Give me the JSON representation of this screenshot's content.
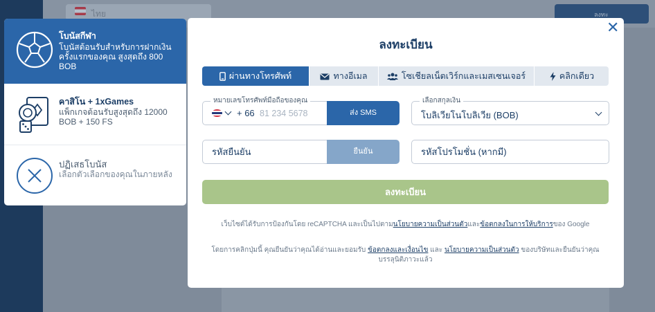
{
  "background": {
    "language_selector": "ไทย",
    "header_button": "ลงทะ"
  },
  "bonus": {
    "sport": {
      "icon": "soccer-ball-icon",
      "title": "โบนัสกีฬา",
      "description": "โบนัสต้อนรับสำหรับการฝากเงินครั้งแรกของคุณ สูงสุดถึง 800 BOB"
    },
    "casino": {
      "icon": "casino-chips-dice-icon",
      "title": "คาสิโน + 1xGames",
      "description": "แพ็กเกจต้อนรับสูงสุดถึง 12000 BOB + 150 FS"
    },
    "reject": {
      "icon": "x-circle-icon",
      "title": "ปฏิเสธโบนัส",
      "description": "เลือกตัวเลือกของคุณในภายหลัง"
    }
  },
  "modal": {
    "title": "ลงทะเบียน",
    "close_icon": "close-icon",
    "tabs": [
      {
        "label": "ผ่านทางโทรศัพท์",
        "icon": "phone-icon",
        "active": true
      },
      {
        "label": "ทางอีเมล",
        "icon": "envelope-icon",
        "active": false
      },
      {
        "label": "โซเชียลเน็ตเวิร์กและเมสเซนเจอร์",
        "icon": "users-icon",
        "active": false
      },
      {
        "label": "คลิกเดียว",
        "icon": "lightning-icon",
        "active": false
      }
    ],
    "phone": {
      "label": "หมายเลขโทรศัพท์มือถือของคุณ",
      "country_code": "+ 66",
      "placeholder": "81 234 5678",
      "send_sms": "ส่ง SMS"
    },
    "currency": {
      "label": "เลือกสกุลเงิน",
      "value": "โบลิเวียโนโบลิเวีย (BOB)"
    },
    "code": {
      "placeholder": "รหัสยืนยัน",
      "confirm": "ยืนยัน"
    },
    "promo": {
      "placeholder": "รหัสโปรโมชั่น (หากมี)"
    },
    "register_button": "ลงทะเบียน",
    "recaptcha": {
      "pre": "เว็บไซต์ได้รับการป้องกันโดย reCAPTCHA และเป็นไปตาม",
      "privacy_link": "นโยบายความเป็นส่วนตัว",
      "and": "และ",
      "terms_link": "ข้อตกลงในการให้บริการ",
      "post": "ของ Google"
    },
    "consent": {
      "pre": "โดยการคลิกปุ่มนี้ คุณยืนยันว่าคุณได้อ่านและยอมรับ ",
      "terms_link": "ข้อตกลงและเงื่อนไข",
      "and": " และ ",
      "privacy_link": "นโยบายความเป็นส่วนตัว",
      "post": " ของบริษัทและยืนยันว่าคุณบรรลุนิติภาวะแล้ว"
    }
  },
  "colors": {
    "primary": "#2b66a9",
    "dark_text": "#1c3e66",
    "register_disabled": "#a9c58a",
    "confirm_disabled": "#85a6c9"
  }
}
